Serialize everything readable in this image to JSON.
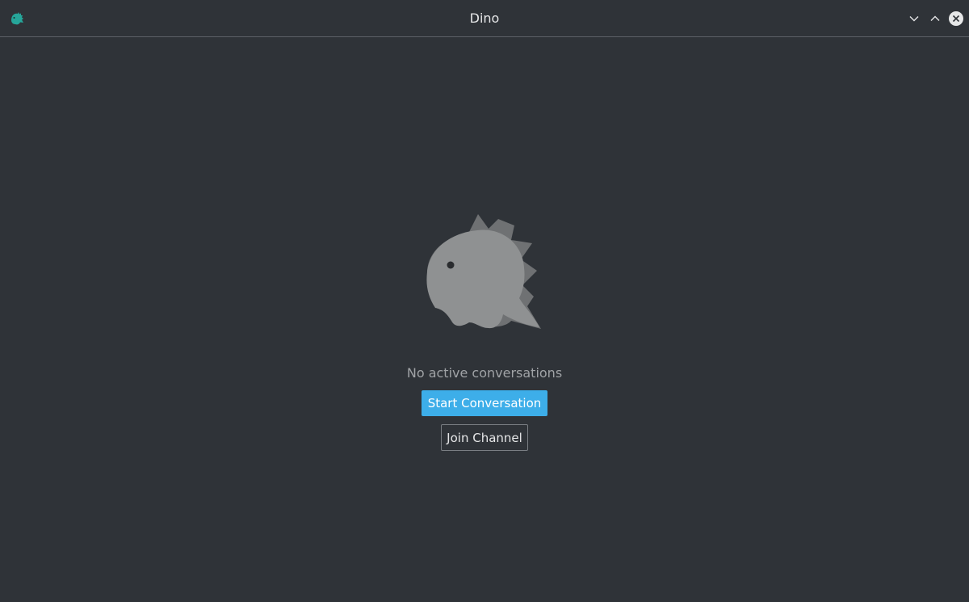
{
  "window": {
    "title": "Dino",
    "app_icon": "dino-app-icon",
    "controls": {
      "minimize_icon": "chevron-down-icon",
      "maximize_icon": "chevron-up-icon",
      "close_icon": "close-icon"
    }
  },
  "empty_state": {
    "illustration": "dino-mascot-icon",
    "message": "No active conversations",
    "primary_action": "Start Conversation",
    "secondary_action": "Join Channel"
  },
  "colors": {
    "background": "#2f3338",
    "accent": "#3daee9",
    "app_icon": "#26a69a",
    "mascot": "#8f9192"
  }
}
